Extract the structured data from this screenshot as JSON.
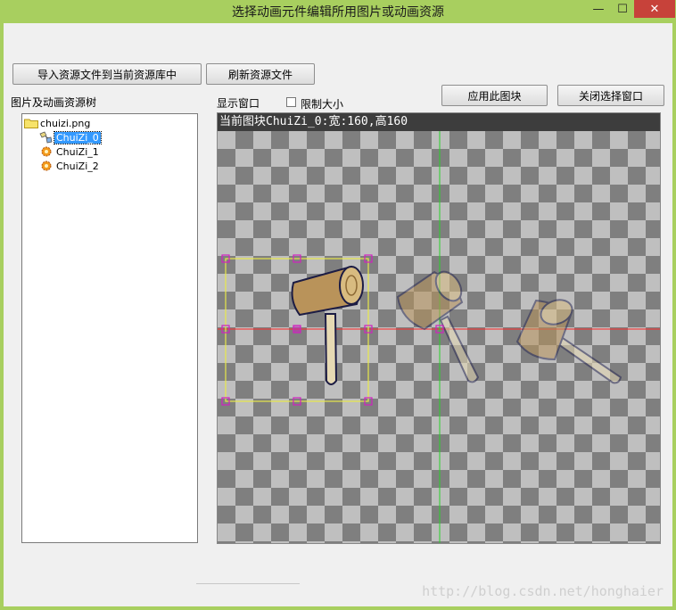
{
  "window": {
    "title": "选择动画元件编辑所用图片或动画资源",
    "minimize": "—",
    "maximize": "☐",
    "close": "✕"
  },
  "toolbar": {
    "import_label": "导入资源文件到当前资源库中",
    "refresh_label": "刷新资源文件"
  },
  "tree": {
    "label": "图片及动画资源树",
    "root": {
      "label": "chuizi.png",
      "icon": "folder-icon"
    },
    "items": [
      {
        "label": "ChuiZi_0",
        "icon": "image-tile-icon",
        "selected": true
      },
      {
        "label": "ChuiZi_1",
        "icon": "animation-gear-icon",
        "selected": false
      },
      {
        "label": "ChuiZi_2",
        "icon": "animation-gear-icon",
        "selected": false
      }
    ]
  },
  "display": {
    "label": "显示窗口",
    "limit_size_label": "限制大小",
    "limit_size_checked": false,
    "apply_label": "应用此图块",
    "close_select_label": "关闭选择窗口",
    "info": "当前图块ChuiZi_0:宽:160,高160"
  },
  "watermark": "http://blog.csdn.net/honghaier",
  "colors": {
    "frame": "#a8cf5f",
    "client": "#f0f0f0",
    "selection": "#3399ff",
    "bbox": "#e8e84a",
    "handle": "#d020c0",
    "h_axis": "#ff2a2a",
    "v_axis": "#2ad02a"
  }
}
